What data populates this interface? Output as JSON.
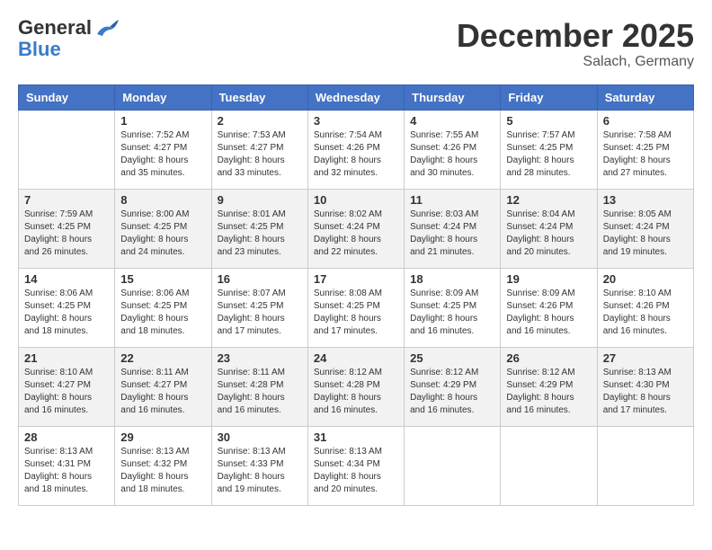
{
  "header": {
    "logo": {
      "general": "General",
      "blue": "Blue"
    },
    "title": "December 2025",
    "location": "Salach, Germany"
  },
  "weekdays": [
    "Sunday",
    "Monday",
    "Tuesday",
    "Wednesday",
    "Thursday",
    "Friday",
    "Saturday"
  ],
  "weeks": [
    [
      {
        "day": "",
        "info": ""
      },
      {
        "day": "1",
        "info": "Sunrise: 7:52 AM\nSunset: 4:27 PM\nDaylight: 8 hours\nand 35 minutes."
      },
      {
        "day": "2",
        "info": "Sunrise: 7:53 AM\nSunset: 4:27 PM\nDaylight: 8 hours\nand 33 minutes."
      },
      {
        "day": "3",
        "info": "Sunrise: 7:54 AM\nSunset: 4:26 PM\nDaylight: 8 hours\nand 32 minutes."
      },
      {
        "day": "4",
        "info": "Sunrise: 7:55 AM\nSunset: 4:26 PM\nDaylight: 8 hours\nand 30 minutes."
      },
      {
        "day": "5",
        "info": "Sunrise: 7:57 AM\nSunset: 4:25 PM\nDaylight: 8 hours\nand 28 minutes."
      },
      {
        "day": "6",
        "info": "Sunrise: 7:58 AM\nSunset: 4:25 PM\nDaylight: 8 hours\nand 27 minutes."
      }
    ],
    [
      {
        "day": "7",
        "info": "Sunrise: 7:59 AM\nSunset: 4:25 PM\nDaylight: 8 hours\nand 26 minutes."
      },
      {
        "day": "8",
        "info": "Sunrise: 8:00 AM\nSunset: 4:25 PM\nDaylight: 8 hours\nand 24 minutes."
      },
      {
        "day": "9",
        "info": "Sunrise: 8:01 AM\nSunset: 4:25 PM\nDaylight: 8 hours\nand 23 minutes."
      },
      {
        "day": "10",
        "info": "Sunrise: 8:02 AM\nSunset: 4:24 PM\nDaylight: 8 hours\nand 22 minutes."
      },
      {
        "day": "11",
        "info": "Sunrise: 8:03 AM\nSunset: 4:24 PM\nDaylight: 8 hours\nand 21 minutes."
      },
      {
        "day": "12",
        "info": "Sunrise: 8:04 AM\nSunset: 4:24 PM\nDaylight: 8 hours\nand 20 minutes."
      },
      {
        "day": "13",
        "info": "Sunrise: 8:05 AM\nSunset: 4:24 PM\nDaylight: 8 hours\nand 19 minutes."
      }
    ],
    [
      {
        "day": "14",
        "info": "Sunrise: 8:06 AM\nSunset: 4:25 PM\nDaylight: 8 hours\nand 18 minutes."
      },
      {
        "day": "15",
        "info": "Sunrise: 8:06 AM\nSunset: 4:25 PM\nDaylight: 8 hours\nand 18 minutes."
      },
      {
        "day": "16",
        "info": "Sunrise: 8:07 AM\nSunset: 4:25 PM\nDaylight: 8 hours\nand 17 minutes."
      },
      {
        "day": "17",
        "info": "Sunrise: 8:08 AM\nSunset: 4:25 PM\nDaylight: 8 hours\nand 17 minutes."
      },
      {
        "day": "18",
        "info": "Sunrise: 8:09 AM\nSunset: 4:25 PM\nDaylight: 8 hours\nand 16 minutes."
      },
      {
        "day": "19",
        "info": "Sunrise: 8:09 AM\nSunset: 4:26 PM\nDaylight: 8 hours\nand 16 minutes."
      },
      {
        "day": "20",
        "info": "Sunrise: 8:10 AM\nSunset: 4:26 PM\nDaylight: 8 hours\nand 16 minutes."
      }
    ],
    [
      {
        "day": "21",
        "info": "Sunrise: 8:10 AM\nSunset: 4:27 PM\nDaylight: 8 hours\nand 16 minutes."
      },
      {
        "day": "22",
        "info": "Sunrise: 8:11 AM\nSunset: 4:27 PM\nDaylight: 8 hours\nand 16 minutes."
      },
      {
        "day": "23",
        "info": "Sunrise: 8:11 AM\nSunset: 4:28 PM\nDaylight: 8 hours\nand 16 minutes."
      },
      {
        "day": "24",
        "info": "Sunrise: 8:12 AM\nSunset: 4:28 PM\nDaylight: 8 hours\nand 16 minutes."
      },
      {
        "day": "25",
        "info": "Sunrise: 8:12 AM\nSunset: 4:29 PM\nDaylight: 8 hours\nand 16 minutes."
      },
      {
        "day": "26",
        "info": "Sunrise: 8:12 AM\nSunset: 4:29 PM\nDaylight: 8 hours\nand 16 minutes."
      },
      {
        "day": "27",
        "info": "Sunrise: 8:13 AM\nSunset: 4:30 PM\nDaylight: 8 hours\nand 17 minutes."
      }
    ],
    [
      {
        "day": "28",
        "info": "Sunrise: 8:13 AM\nSunset: 4:31 PM\nDaylight: 8 hours\nand 18 minutes."
      },
      {
        "day": "29",
        "info": "Sunrise: 8:13 AM\nSunset: 4:32 PM\nDaylight: 8 hours\nand 18 minutes."
      },
      {
        "day": "30",
        "info": "Sunrise: 8:13 AM\nSunset: 4:33 PM\nDaylight: 8 hours\nand 19 minutes."
      },
      {
        "day": "31",
        "info": "Sunrise: 8:13 AM\nSunset: 4:34 PM\nDaylight: 8 hours\nand 20 minutes."
      },
      {
        "day": "",
        "info": ""
      },
      {
        "day": "",
        "info": ""
      },
      {
        "day": "",
        "info": ""
      }
    ]
  ]
}
